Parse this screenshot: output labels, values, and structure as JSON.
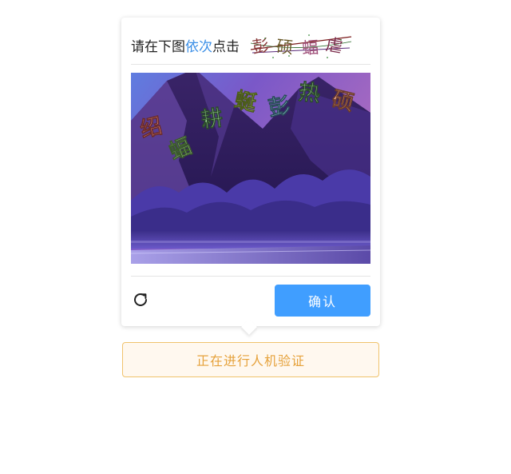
{
  "captcha": {
    "instruction": {
      "prefix": "请在下图",
      "highlight": "依次",
      "suffix": "点击"
    },
    "target_chars": [
      "彭",
      "硕",
      "蝠",
      "虐"
    ],
    "image_chars": [
      "绍",
      "蝠",
      "耕",
      "蜒",
      "彭",
      "热",
      "硕"
    ],
    "confirm_label": "确认",
    "status_text": "正在进行人机验证",
    "colors": {
      "accent": "#409eff",
      "highlight": "#3a8ee6",
      "status_border": "#f0c36d",
      "status_text": "#e6a23c",
      "status_bg": "#fff8ef"
    }
  }
}
